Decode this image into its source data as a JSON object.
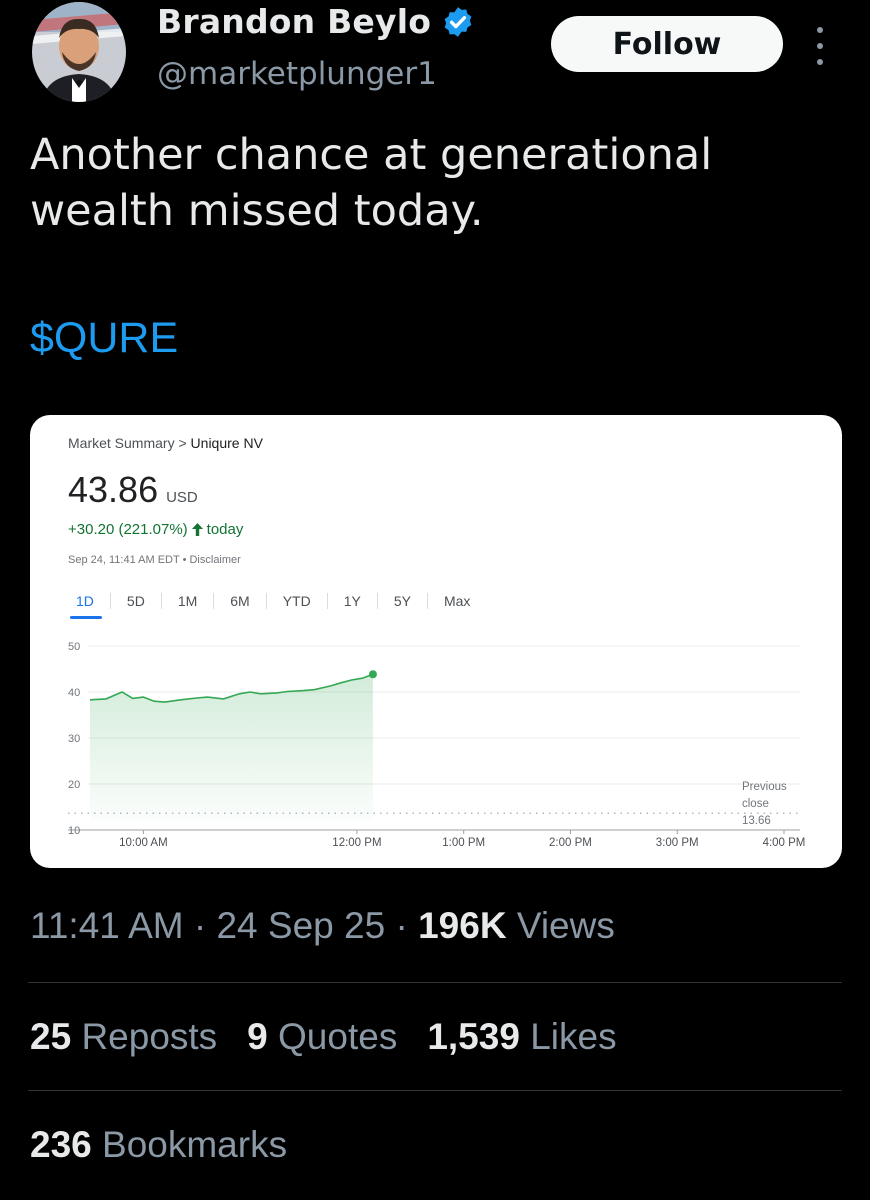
{
  "author": {
    "name": "Brandon Beylo",
    "handle": "@marketplunger1",
    "follow_label": "Follow"
  },
  "tweet": {
    "text_line1": "Another chance at generational",
    "text_line2": "wealth missed today.",
    "cashtag": "$QURE"
  },
  "card": {
    "breadcrumb_parent": "Market Summary",
    "breadcrumb_sep": ">",
    "breadcrumb_current": "Uniqure NV",
    "price": "43.86",
    "currency": "USD",
    "change": "+30.20 (221.07%)",
    "change_suffix": "today",
    "timestamp": "Sep 24, 11:41 AM EDT",
    "disclaimer": "Disclaimer",
    "ranges": [
      "1D",
      "5D",
      "1M",
      "6M",
      "YTD",
      "1Y",
      "5Y",
      "Max"
    ],
    "active_range": "1D",
    "colors": {
      "line": "#34a853",
      "accent": "#1a73e8",
      "up": "#137333"
    }
  },
  "chart_data": {
    "type": "line",
    "y_ticks": [
      "50",
      "40",
      "30",
      "20",
      "10"
    ],
    "ylim": [
      10,
      50
    ],
    "x_ticks": [
      "10:00 AM",
      "12:00 PM",
      "1:00 PM",
      "2:00 PM",
      "3:00 PM",
      "4:00 PM"
    ],
    "x_tick_hours": [
      10,
      12,
      13,
      14,
      15,
      16
    ],
    "xlim_hours": [
      9.5,
      16.15
    ],
    "previous_close_label": "Previous close",
    "previous_close_value": "13.66",
    "previous_close": 13.66,
    "series": [
      {
        "x_hours": [
          9.5,
          9.65,
          9.8,
          9.9,
          10.0,
          10.1,
          10.2,
          10.35,
          10.5,
          10.6,
          10.75,
          10.9,
          11.0,
          11.1,
          11.25,
          11.35,
          11.5,
          11.6,
          11.75,
          11.85,
          11.95,
          12.05,
          12.15
        ],
        "values": [
          38.3,
          38.5,
          40.0,
          38.6,
          38.9,
          38.0,
          37.8,
          38.3,
          38.7,
          38.9,
          38.5,
          39.6,
          40.0,
          39.6,
          39.8,
          40.1,
          40.3,
          40.5,
          41.3,
          42.0,
          42.6,
          43.0,
          43.86
        ]
      }
    ],
    "grid": true
  },
  "meta": {
    "time": "11:41 AM",
    "date": "24 Sep 25",
    "views_count": "196K",
    "views_label": "Views",
    "separator": "·"
  },
  "stats": {
    "reposts_count": "25",
    "reposts_label": "Reposts",
    "quotes_count": "9",
    "quotes_label": "Quotes",
    "likes_count": "1,539",
    "likes_label": "Likes",
    "bookmarks_count": "236",
    "bookmarks_label": "Bookmarks"
  }
}
